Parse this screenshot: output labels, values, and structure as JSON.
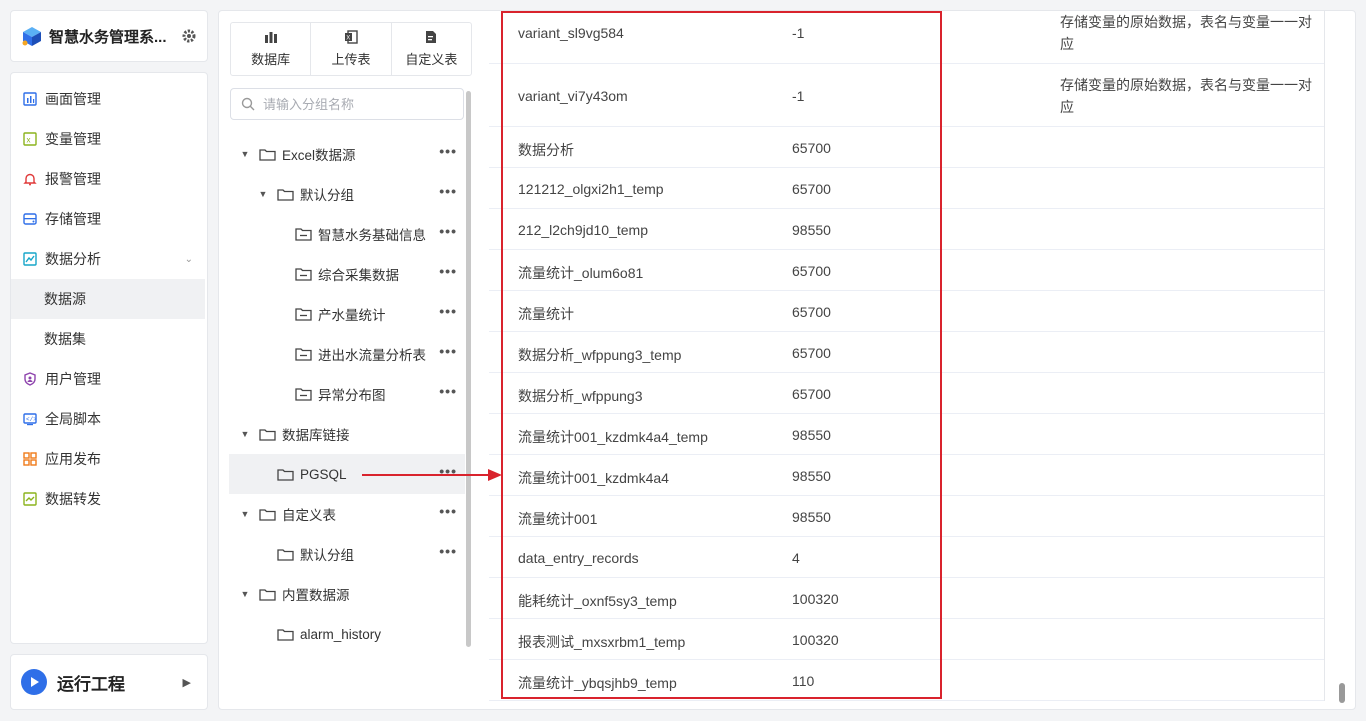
{
  "brand": {
    "title": "智慧水务管理系...",
    "icons": {
      "logo": "cube-logo-icon",
      "settings": "gear-icon"
    }
  },
  "nav": {
    "items": [
      {
        "label": "画面管理",
        "icon": "screen-icon",
        "color": "#2f6fe8"
      },
      {
        "label": "变量管理",
        "icon": "variable-icon",
        "color": "#8bb31d"
      },
      {
        "label": "报警管理",
        "icon": "bell-icon",
        "color": "#e03a3a"
      },
      {
        "label": "存储管理",
        "icon": "storage-icon",
        "color": "#2f6fe8"
      },
      {
        "label": "数据分析",
        "icon": "chart-icon",
        "color": "#16a6c9",
        "expanded": true
      },
      {
        "label": "数据源",
        "sub": true,
        "active": true
      },
      {
        "label": "数据集",
        "sub": true
      },
      {
        "label": "用户管理",
        "icon": "shield-user-icon",
        "color": "#8e44ad"
      },
      {
        "label": "全局脚本",
        "icon": "script-icon",
        "color": "#2f6fe8"
      },
      {
        "label": "应用发布",
        "icon": "apps-icon",
        "color": "#f07b1a"
      },
      {
        "label": "数据转发",
        "icon": "forward-icon",
        "color": "#8bb31d"
      }
    ]
  },
  "run": {
    "label": "运行工程"
  },
  "toolbar": {
    "database": "数据库",
    "upload": "上传表",
    "custom": "自定义表"
  },
  "search": {
    "placeholder": "请输入分组名称",
    "value": ""
  },
  "tree": [
    {
      "label": "Excel数据源",
      "level": 0,
      "toggle": true,
      "more": true
    },
    {
      "label": "默认分组",
      "level": 1,
      "toggle": true,
      "more": true
    },
    {
      "label": "智慧水务基础信息",
      "level": 2,
      "more": true,
      "table": true
    },
    {
      "label": "综合采集数据",
      "level": 2,
      "more": true,
      "table": true
    },
    {
      "label": "产水量统计",
      "level": 2,
      "more": true,
      "table": true
    },
    {
      "label": "进出水流量分析表",
      "level": 2,
      "more": true,
      "table": true
    },
    {
      "label": "异常分布图",
      "level": 2,
      "more": true,
      "table": true
    },
    {
      "label": "数据库链接",
      "level": 0,
      "toggle": true,
      "more": false
    },
    {
      "label": "PGSQL",
      "level": 1,
      "more": true,
      "selected": true
    },
    {
      "label": "自定义表",
      "level": 0,
      "toggle": true,
      "more": true
    },
    {
      "label": "默认分组",
      "level": 1,
      "more": true
    },
    {
      "label": "内置数据源",
      "level": 0,
      "toggle": true,
      "more": false
    },
    {
      "label": "alarm_history",
      "level": 1,
      "more": false
    },
    {
      "label": "",
      "level": 1,
      "more": false
    }
  ],
  "table": {
    "rows": [
      {
        "name": "variant_sl9vg584",
        "count": "-1",
        "desc": "存储变量的原始数据，表名与变量一一对应"
      },
      {
        "name": "variant_vi7y43om",
        "count": "-1",
        "desc": "存储变量的原始数据，表名与变量一一对应"
      },
      {
        "name": "数据分析",
        "count": "65700",
        "desc": ""
      },
      {
        "name": "121212_olgxi2h1_temp",
        "count": "65700",
        "desc": ""
      },
      {
        "name": "212_l2ch9jd10_temp",
        "count": "98550",
        "desc": ""
      },
      {
        "name": "流量统计_olum6o81",
        "count": "65700",
        "desc": ""
      },
      {
        "name": "流量统计",
        "count": "65700",
        "desc": ""
      },
      {
        "name": "数据分析_wfppung3_temp",
        "count": "65700",
        "desc": ""
      },
      {
        "name": "数据分析_wfppung3",
        "count": "65700",
        "desc": ""
      },
      {
        "name": "流量统计001_kzdmk4a4_temp",
        "count": "98550",
        "desc": ""
      },
      {
        "name": "流量统计001_kzdmk4a4",
        "count": "98550",
        "desc": ""
      },
      {
        "name": "流量统计001",
        "count": "98550",
        "desc": ""
      },
      {
        "name": "data_entry_records",
        "count": "4",
        "desc": ""
      },
      {
        "name": "能耗统计_oxnf5sy3_temp",
        "count": "100320",
        "desc": ""
      },
      {
        "name": "报表测试_mxsxrbm1_temp",
        "count": "100320",
        "desc": ""
      },
      {
        "name": "流量统计_ybqsjhb9_temp",
        "count": "110",
        "desc": ""
      }
    ]
  },
  "colors": {
    "accent": "#2f6fe8",
    "annotation": "#d9232d",
    "selected_bg": "#f0f1f3"
  }
}
